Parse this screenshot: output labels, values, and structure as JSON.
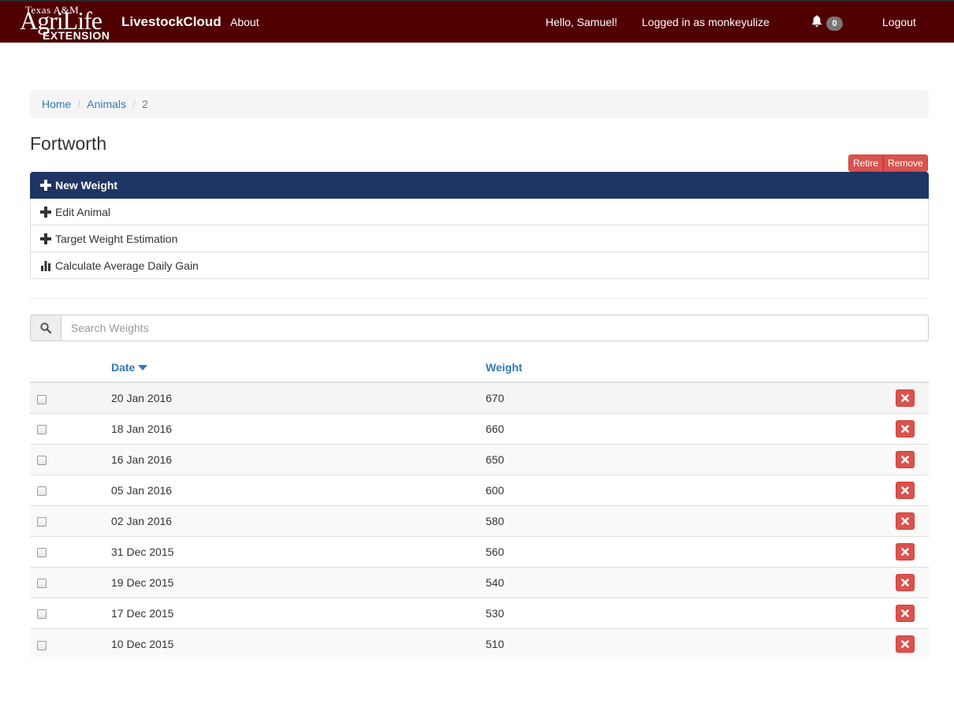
{
  "navbar": {
    "logo": {
      "line1": "Texas A&M",
      "line2": "AgriLife",
      "line3": "EXTENSION"
    },
    "brand": "LivestockCloud",
    "about": "About",
    "greeting": "Hello, Samuel!",
    "logged_in": "Logged in as monkeyulize",
    "notification_count": "0",
    "logout": "Logout",
    "color": "#500000"
  },
  "breadcrumb": {
    "home": "Home",
    "animals": "Animals",
    "current": "2"
  },
  "page": {
    "title": "Fortworth",
    "retire_label": "Retire",
    "remove_label": "Remove"
  },
  "actions": [
    {
      "icon": "plus-icon",
      "label": "New Weight"
    },
    {
      "icon": "plus-icon",
      "label": "Edit Animal"
    },
    {
      "icon": "plus-icon",
      "label": "Target Weight Estimation"
    },
    {
      "icon": "bar-chart-icon",
      "label": "Calculate Average Daily Gain"
    }
  ],
  "search": {
    "placeholder": "Search Weights"
  },
  "table": {
    "headers": {
      "date": "Date",
      "weight": "Weight"
    },
    "sort": {
      "column": "date",
      "direction": "descending"
    },
    "rows": [
      {
        "date": "20 Jan 2016",
        "weight": "670"
      },
      {
        "date": "18 Jan 2016",
        "weight": "660"
      },
      {
        "date": "16 Jan 2016",
        "weight": "650"
      },
      {
        "date": "05 Jan 2016",
        "weight": "600"
      },
      {
        "date": "02 Jan 2016",
        "weight": "580"
      },
      {
        "date": "31 Dec 2015",
        "weight": "560"
      },
      {
        "date": "19 Dec 2015",
        "weight": "540"
      },
      {
        "date": "17 Dec 2015",
        "weight": "530"
      },
      {
        "date": "10 Dec 2015",
        "weight": "510"
      }
    ]
  },
  "colors": {
    "accent": "#1f3563",
    "danger": "#d9534f",
    "link": "#337ab7"
  }
}
